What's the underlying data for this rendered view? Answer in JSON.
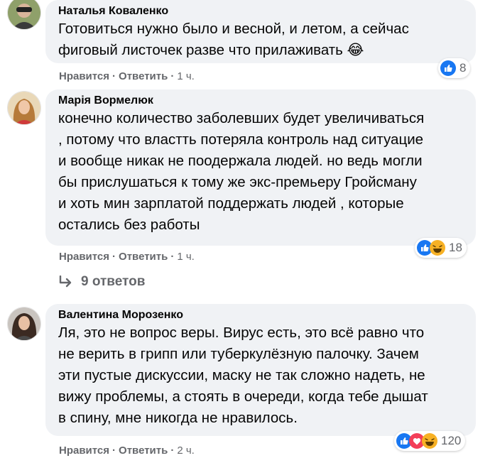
{
  "comments": [
    {
      "author": "Наталья Коваленко",
      "lines": [
        "Готовиться нужно было и весной, и летом, а сейчас",
        "фиговый листочек разве что прилаживать 😂"
      ],
      "like_label": "Нравится",
      "reply_label": "Ответить",
      "time": "1 ч.",
      "reaction_count": "8",
      "reaction_icons": [
        "like-icon"
      ]
    },
    {
      "author": "Марія Вормелюк",
      "lines": [
        "конечно количество заболевших будет увеличиваться",
        ", потому что властть потеряла контроль над ситуацие",
        "и вообще никак не поодержала людей. но ведь могли",
        "бы прислушаться к тому же экс-премьеру Гройсману",
        "и хоть мин зарплатой поддержать людей , которые",
        "остались без работы"
      ],
      "like_label": "Нравится",
      "reply_label": "Ответить",
      "time": "1 ч.",
      "reaction_count": "18",
      "reaction_icons": [
        "like-icon",
        "laugh-icon"
      ],
      "replies_label": "9 ответов"
    },
    {
      "author": "Валентина Морозенко",
      "lines": [
        "Ля, это не вопрос веры. Вирус есть, это всё равно что",
        "не верить в грипп или туберкулёзную палочку. Зачем",
        "эти пустые дискуссии, маску не так сложно надеть, не",
        "вижу проблемы, а стоять в очереди, когда тебе дышат",
        "в спину, мне никогда не нравилось."
      ],
      "like_label": "Нравится",
      "reply_label": "Ответить",
      "time": "2 ч.",
      "reaction_count": "120",
      "reaction_icons": [
        "like-icon",
        "love-icon",
        "laugh-icon"
      ]
    }
  ],
  "separator": "·",
  "colors": {
    "bubble": "#f0f2f5",
    "meta_text": "#65676b",
    "like_blue": "#1877f2",
    "love_red": "#f33e58",
    "laugh_yellow": "#f7b125"
  }
}
